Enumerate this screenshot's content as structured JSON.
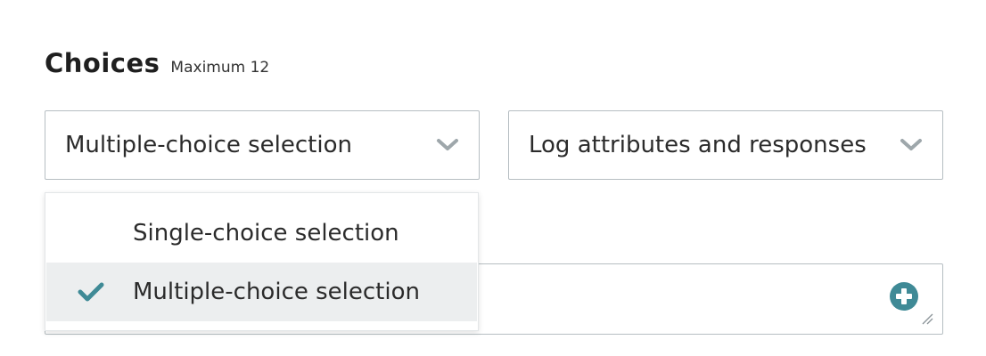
{
  "section": {
    "title": "Choices",
    "subtitle": "Maximum 12"
  },
  "selection_type": {
    "value": "Multiple-choice selection",
    "options": [
      {
        "label": "Single-choice selection",
        "selected": false
      },
      {
        "label": "Multiple-choice selection",
        "selected": true
      }
    ]
  },
  "logging": {
    "value": "Log attributes and responses"
  },
  "colors": {
    "accent": "#3f8a96",
    "border": "#b6bec2",
    "selected_bg": "#eceeef",
    "chevron": "#9ea7ab"
  },
  "icons": {
    "chevron": "chevron-down-icon",
    "check": "check-icon",
    "add": "plus-circle-icon",
    "resize": "resize-handle-icon"
  }
}
